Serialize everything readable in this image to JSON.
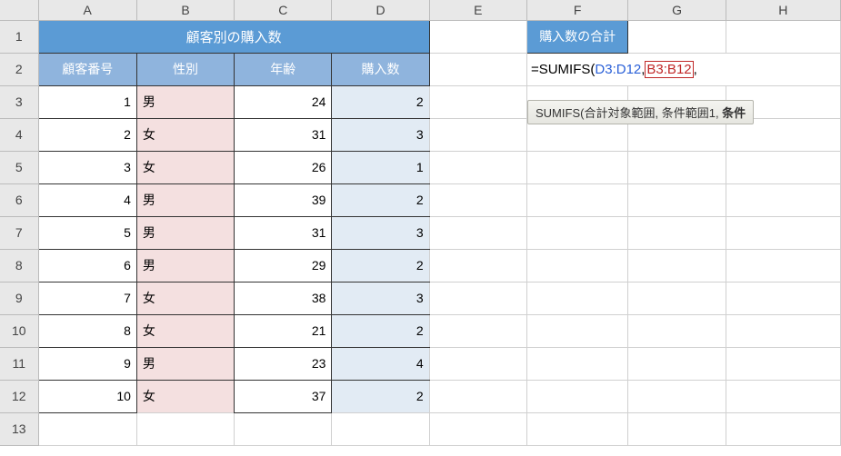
{
  "columns": [
    "A",
    "B",
    "C",
    "D",
    "E",
    "F",
    "G",
    "H"
  ],
  "rows": [
    "1",
    "2",
    "3",
    "4",
    "5",
    "6",
    "7",
    "8",
    "9",
    "10",
    "11",
    "12",
    "13"
  ],
  "table_title": "顧客別の購入数",
  "right_title": "購入数の合計",
  "headers": {
    "customer_no": "顧客番号",
    "gender": "性別",
    "age": "年齢",
    "purchases": "購入数"
  },
  "data_rows": [
    {
      "no": "1",
      "gender": "男",
      "age": "24",
      "buy": "2"
    },
    {
      "no": "2",
      "gender": "女",
      "age": "31",
      "buy": "3"
    },
    {
      "no": "3",
      "gender": "女",
      "age": "26",
      "buy": "1"
    },
    {
      "no": "4",
      "gender": "男",
      "age": "39",
      "buy": "2"
    },
    {
      "no": "5",
      "gender": "男",
      "age": "31",
      "buy": "3"
    },
    {
      "no": "6",
      "gender": "男",
      "age": "29",
      "buy": "2"
    },
    {
      "no": "7",
      "gender": "女",
      "age": "38",
      "buy": "3"
    },
    {
      "no": "8",
      "gender": "女",
      "age": "21",
      "buy": "2"
    },
    {
      "no": "9",
      "gender": "男",
      "age": "23",
      "buy": "4"
    },
    {
      "no": "10",
      "gender": "女",
      "age": "37",
      "buy": "2"
    }
  ],
  "formula": {
    "prefix": "=SUMIFS(",
    "ref1": "D3:D12",
    "sep1": ",",
    "ref2": "B3:B12",
    "suffix": ","
  },
  "tooltip": {
    "fn": "SUMIFS(",
    "arg1": "合計対象範囲",
    "arg2": "条件範囲1",
    "arg3_bold": "条件"
  }
}
